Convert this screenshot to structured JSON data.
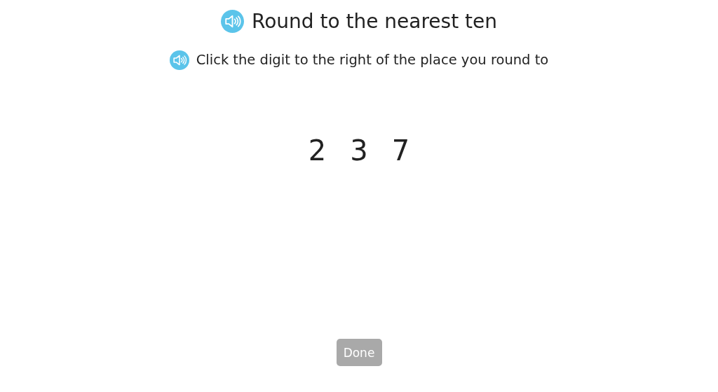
{
  "title": {
    "text": "Round to the nearest ten"
  },
  "instruction": {
    "text": "Click the digit to the right of the place you round to"
  },
  "digits": [
    {
      "text": "2",
      "selected": false
    },
    {
      "text": "3",
      "selected": false
    },
    {
      "text": "7",
      "selected": false
    }
  ],
  "done_button": {
    "label": "Done",
    "disabled": true
  }
}
